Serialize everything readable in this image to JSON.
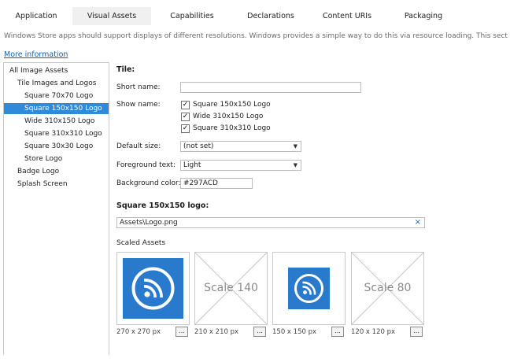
{
  "tabs": [
    "Application",
    "Visual Assets",
    "Capabilities",
    "Declarations",
    "Content URIs",
    "Packaging"
  ],
  "active_tab": "Visual Assets",
  "description": "Windows Store apps should support displays of different resolutions. Windows provides a simple way to do this via resource loading. This section lists all the as",
  "more_info": "More information",
  "tree": {
    "items": [
      "All Image Assets",
      "Tile Images and Logos",
      "Square 70x70 Logo",
      "Square 150x150 Logo",
      "Wide 310x150 Logo",
      "Square 310x310 Logo",
      "Square 30x30 Logo",
      "Store Logo",
      "Badge Logo",
      "Splash Screen"
    ],
    "selected": "Square 150x150 Logo"
  },
  "tile": {
    "heading": "Tile:",
    "short_name_label": "Short name:",
    "short_name_value": "",
    "show_name_label": "Show name:",
    "show_name_options": [
      {
        "label": "Square 150x150 Logo",
        "checked": true
      },
      {
        "label": "Wide 310x150 Logo",
        "checked": true
      },
      {
        "label": "Square 310x310 Logo",
        "checked": true
      }
    ],
    "default_size_label": "Default size:",
    "default_size_value": "(not set)",
    "foreground_label": "Foreground text:",
    "foreground_value": "Light",
    "background_label": "Background color:",
    "background_value": "#297ACD"
  },
  "logo": {
    "heading": "Square 150x150 logo:",
    "path": "Assets\\Logo.png",
    "clear_glyph": "×"
  },
  "scaled": {
    "heading": "Scaled Assets",
    "dots_label": "...",
    "assets": [
      {
        "type": "image",
        "size": "270 x 270 px"
      },
      {
        "type": "placeholder",
        "text": "Scale 140",
        "size": "210 x 210 px"
      },
      {
        "type": "image",
        "size": "150 x 150 px"
      },
      {
        "type": "placeholder",
        "text": "Scale 80",
        "size": "120 x 120 px"
      }
    ]
  },
  "colors": {
    "accent": "#297acd",
    "selection": "#2f8ad9",
    "link": "#0e5fb8"
  },
  "icons": {
    "logo": "rss-feed-icon",
    "placeholder": "cross-placeholder-icon",
    "checkbox": "checkmark-icon",
    "dropdown": "chevron-down-icon"
  },
  "glyphs": {
    "check": "✓",
    "dropdown": "▼"
  }
}
